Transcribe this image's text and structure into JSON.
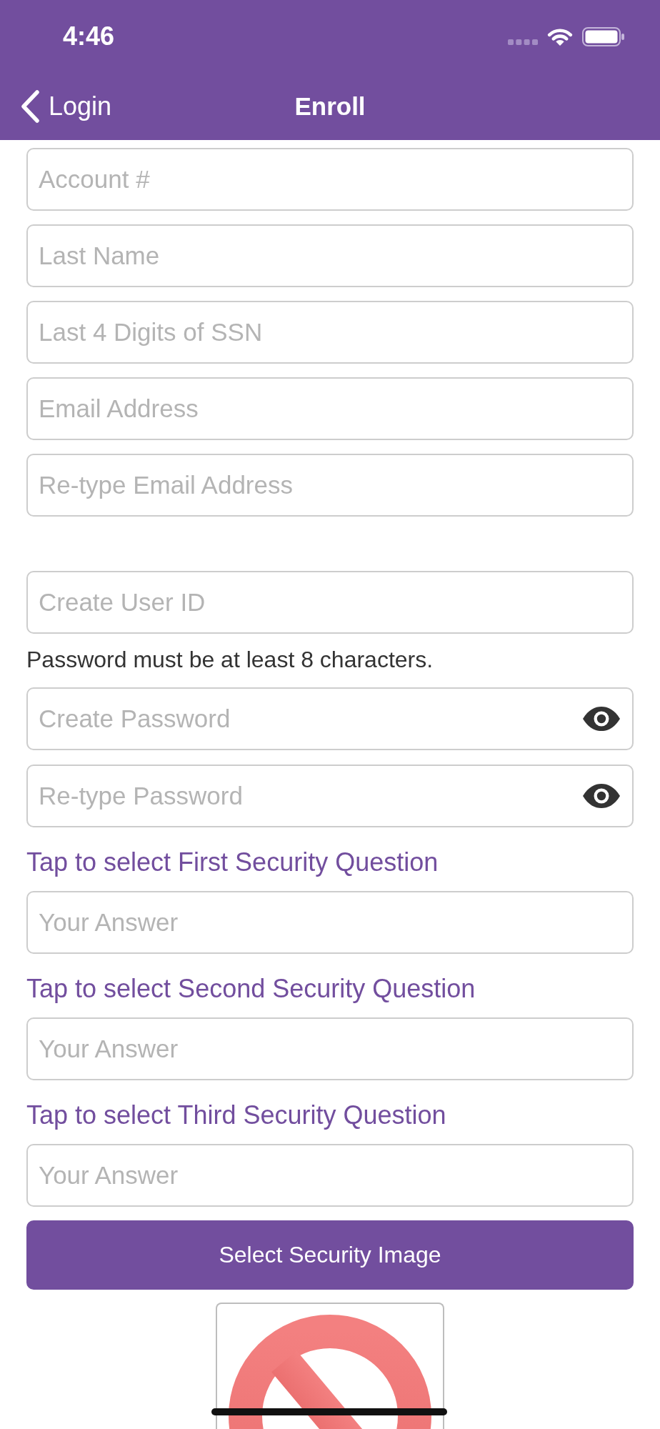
{
  "status_bar": {
    "time": "4:46"
  },
  "nav_bar": {
    "back_label": "Login",
    "title": "Enroll"
  },
  "account_fields": [
    {
      "placeholder": "Account #"
    },
    {
      "placeholder": "Last Name"
    },
    {
      "placeholder": "Last 4 Digits of SSN"
    },
    {
      "placeholder": "Email Address"
    },
    {
      "placeholder": "Re-type Email Address"
    }
  ],
  "user_id_field": {
    "placeholder": "Create User ID"
  },
  "password_hint": "Password must be at least 8 characters.",
  "password_fields": [
    {
      "placeholder": "Create Password"
    },
    {
      "placeholder": "Re-type Password"
    }
  ],
  "security_questions": [
    {
      "prompt": "Tap to select First Security Question",
      "answer_placeholder": "Your Answer"
    },
    {
      "prompt": "Tap to select Second Security Question",
      "answer_placeholder": "Your Answer"
    },
    {
      "prompt": "Tap to select Third Security Question",
      "answer_placeholder": "Your Answer"
    }
  ],
  "security_image_button": {
    "label": "Select Security Image"
  }
}
